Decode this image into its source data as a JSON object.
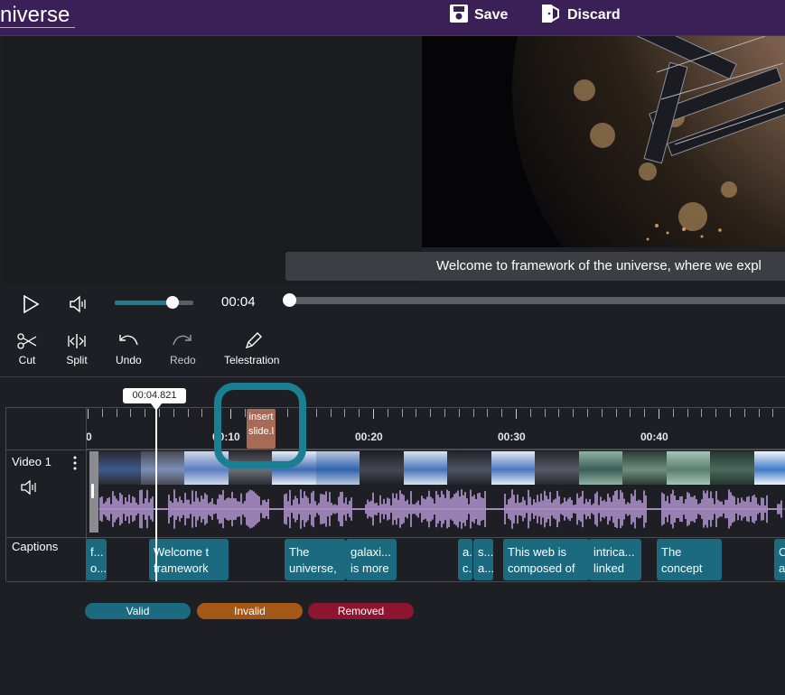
{
  "header": {
    "app_title": "niverse",
    "save_label": "Save",
    "discard_label": "Discard"
  },
  "preview": {
    "caption_text": "Welcome to framework of the universe, where we expl"
  },
  "player": {
    "current_time": "00:04",
    "volume_fraction": 0.73,
    "seek_fraction": 0.0
  },
  "toolbar": {
    "cut_label": "Cut",
    "split_label": "Split",
    "undo_label": "Undo",
    "redo_label": "Redo",
    "telestration_label": "Telestration"
  },
  "timeline": {
    "playhead_time": "00:04.821",
    "ticks": [
      "0",
      "00:10",
      "00:20",
      "00:30",
      "00:40"
    ],
    "insert_marker": [
      "insert",
      "slide.l"
    ],
    "tracks": {
      "video_label": "Video 1",
      "captions_label": "Captions"
    },
    "captions": [
      {
        "line1": "f...",
        "line2": "o..."
      },
      {
        "line1": "Welcome t",
        "line2": "framework"
      },
      {
        "line1": "",
        "line2": ""
      },
      {
        "line1": "The",
        "line2": "universe,"
      },
      {
        "line1": "galaxi...",
        "line2": "is more"
      },
      {
        "line1": "a.",
        "line2": "c."
      },
      {
        "line1": "s...",
        "line2": "a..."
      },
      {
        "line1": "This web is",
        "line2": "composed of"
      },
      {
        "line1": "intrica...",
        "line2": "linked"
      },
      {
        "line1": "The",
        "line2": "concept"
      },
      {
        "line1": "C",
        "line2": "a"
      }
    ]
  },
  "legend": {
    "valid": "Valid",
    "invalid": "Invalid",
    "removed": "Removed"
  },
  "colors": {
    "header_bg": "#3a2057",
    "accent_teal": "#1a7f92",
    "caption_valid": "#1c6a7f",
    "caption_invalid": "#a35818",
    "caption_removed": "#8e1530",
    "insert_marker": "#a76a56",
    "waveform": "#b79ad6"
  }
}
